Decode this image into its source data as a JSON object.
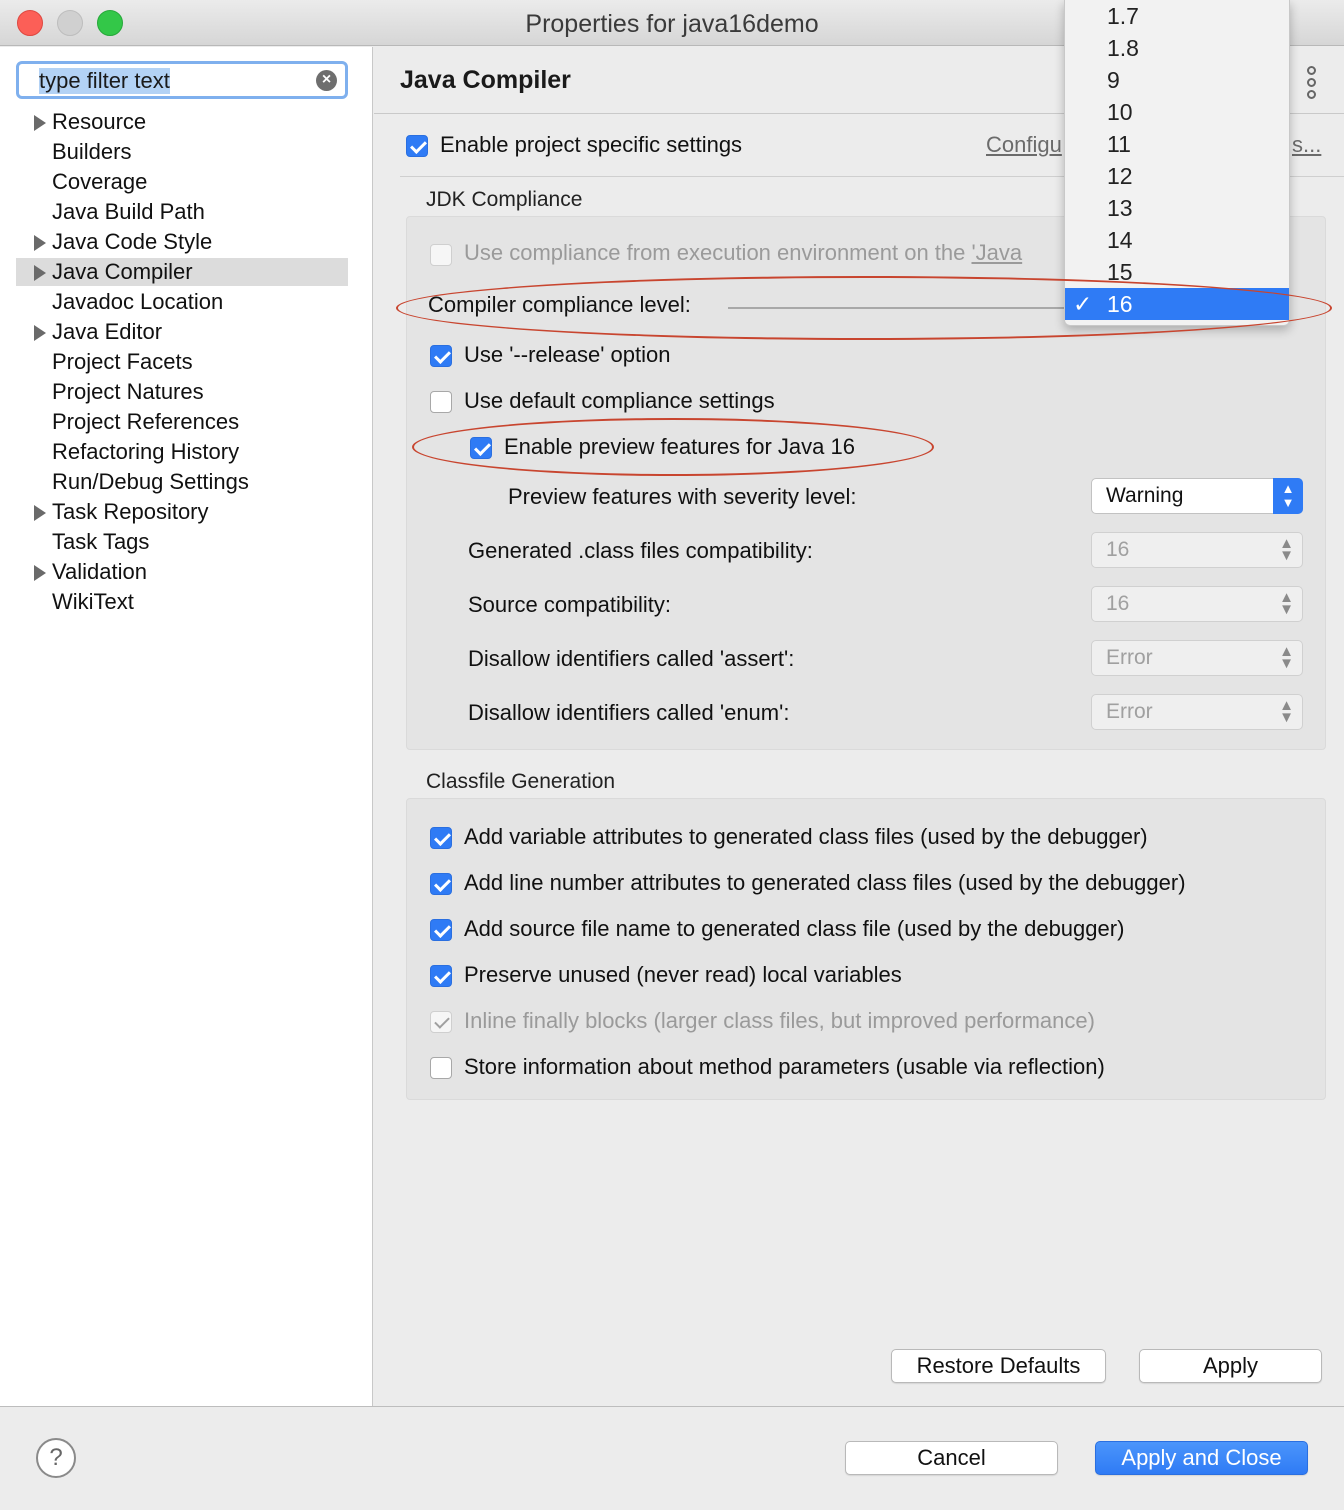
{
  "window": {
    "title": "Properties for java16demo"
  },
  "sidebar": {
    "filter_placeholder": "type filter text",
    "items": [
      {
        "label": "Resource",
        "expandable": true
      },
      {
        "label": "Builders",
        "expandable": false
      },
      {
        "label": "Coverage",
        "expandable": false
      },
      {
        "label": "Java Build Path",
        "expandable": false
      },
      {
        "label": "Java Code Style",
        "expandable": true
      },
      {
        "label": "Java Compiler",
        "expandable": true,
        "selected": true
      },
      {
        "label": "Javadoc Location",
        "expandable": false
      },
      {
        "label": "Java Editor",
        "expandable": true
      },
      {
        "label": "Project Facets",
        "expandable": false
      },
      {
        "label": "Project Natures",
        "expandable": false
      },
      {
        "label": "Project References",
        "expandable": false
      },
      {
        "label": "Refactoring History",
        "expandable": false
      },
      {
        "label": "Run/Debug Settings",
        "expandable": false
      },
      {
        "label": "Task Repository",
        "expandable": true
      },
      {
        "label": "Task Tags",
        "expandable": false
      },
      {
        "label": "Validation",
        "expandable": true
      },
      {
        "label": "WikiText",
        "expandable": false
      }
    ]
  },
  "main": {
    "title": "Java Compiler",
    "enable_project_settings": {
      "label": "Enable project specific settings",
      "checked": true
    },
    "configure_link_left": "Configu",
    "configure_link_right": "s...",
    "jdk": {
      "group_title": "JDK Compliance",
      "use_env": {
        "label": "Use compliance from execution environment on the ",
        "link": "'Java",
        "checked": false
      },
      "compliance_label": "Compiler compliance level:",
      "use_release": {
        "label": "Use '--release' option",
        "checked": true
      },
      "use_default": {
        "label": "Use default compliance settings",
        "checked": false
      },
      "enable_preview": {
        "label": "Enable preview features for Java 16",
        "checked": true
      },
      "preview_severity": {
        "label": "Preview features with severity level:",
        "value": "Warning"
      },
      "class_compat": {
        "label": "Generated .class files compatibility:",
        "value": "16"
      },
      "source_compat": {
        "label": "Source compatibility:",
        "value": "16"
      },
      "assert_ident": {
        "label": "Disallow identifiers called 'assert':",
        "value": "Error"
      },
      "enum_ident": {
        "label": "Disallow identifiers called 'enum':",
        "value": "Error"
      }
    },
    "classfile": {
      "group_title": "Classfile Generation",
      "options": [
        {
          "label": "Add variable attributes to generated class files (used by the debugger)",
          "state": "on"
        },
        {
          "label": "Add line number attributes to generated class files (used by the debugger)",
          "state": "on"
        },
        {
          "label": "Add source file name to generated class file (used by the debugger)",
          "state": "on"
        },
        {
          "label": "Preserve unused (never read) local variables",
          "state": "on"
        },
        {
          "label": "Inline finally blocks (larger class files, but improved performance)",
          "state": "disabled-on"
        },
        {
          "label": "Store information about method parameters (usable via reflection)",
          "state": "off"
        }
      ]
    },
    "restore_defaults": "Restore Defaults",
    "apply": "Apply"
  },
  "dropdown": {
    "options": [
      "1.7",
      "1.8",
      "9",
      "10",
      "11",
      "12",
      "13",
      "14",
      "15",
      "16"
    ],
    "selected": "16",
    "check_glyph": "✓"
  },
  "footer": {
    "help_icon": "?",
    "cancel": "Cancel",
    "apply_close": "Apply and Close"
  },
  "colors": {
    "accent": "#2f7bf5",
    "annotation": "#c8452f"
  }
}
